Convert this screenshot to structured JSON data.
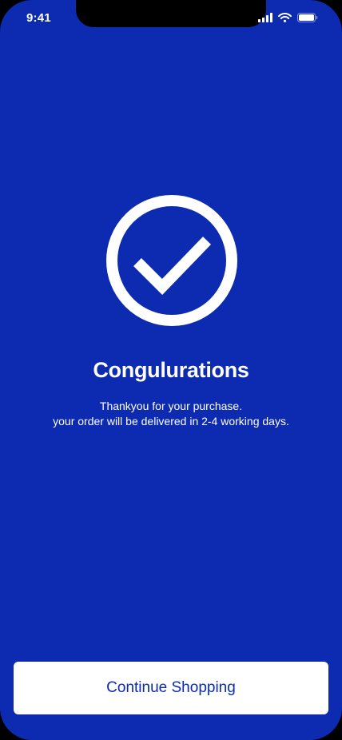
{
  "status_bar": {
    "time": "9:41",
    "icons": [
      "cellular-signal-icon",
      "wifi-icon",
      "battery-icon"
    ]
  },
  "confirmation": {
    "icon": "check-circle-icon",
    "title": "Congulurations",
    "message_line_1": "Thankyou for your purchase.",
    "message_line_2": "your order will be delivered in 2-4 working days."
  },
  "actions": {
    "continue_label": "Continue Shopping"
  },
  "colors": {
    "background": "#0c2bb0",
    "foreground": "#ffffff",
    "button_text": "#0c2bb0"
  }
}
